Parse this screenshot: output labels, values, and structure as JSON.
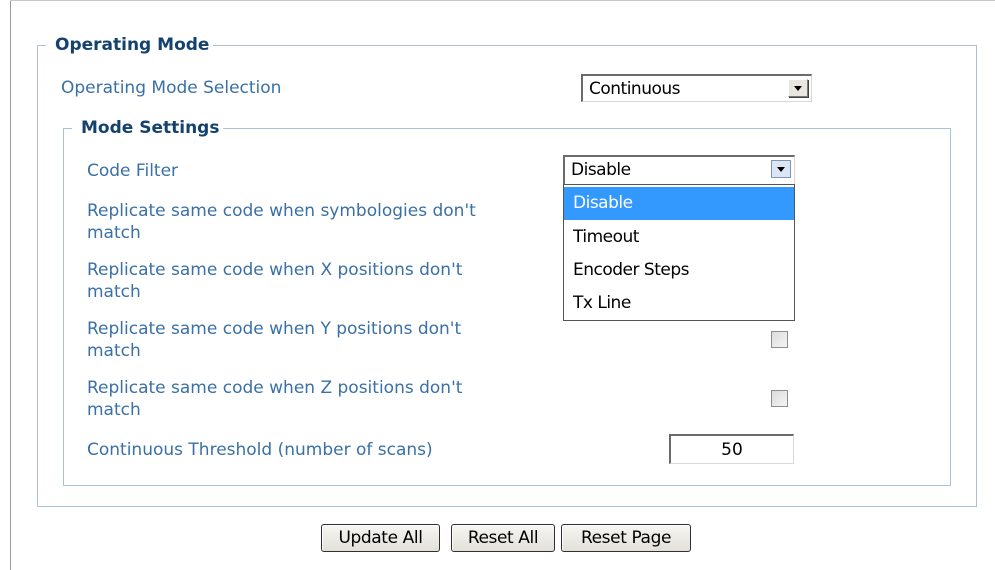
{
  "operating_mode": {
    "legend": "Operating Mode",
    "selection_label": "Operating Mode Selection",
    "selection_value": "Continuous"
  },
  "mode_settings": {
    "legend": "Mode Settings",
    "code_filter": {
      "label": "Code Filter",
      "value": "Disable",
      "options": [
        {
          "label": "Disable",
          "selected": true
        },
        {
          "label": "Timeout",
          "selected": false
        },
        {
          "label": "Encoder Steps",
          "selected": false
        },
        {
          "label": "Tx Line",
          "selected": false
        }
      ]
    },
    "replicate_symbologies": {
      "line1": "Replicate same code when symbologies don't",
      "line2": "match"
    },
    "replicate_x": {
      "line1": "Replicate same code when X positions don't",
      "line2": "match"
    },
    "replicate_y": {
      "line1": "Replicate same code when Y positions don't",
      "line2": "match",
      "checked": false
    },
    "replicate_z": {
      "line1": "Replicate same code when Z positions don't",
      "line2": "match",
      "checked": false
    },
    "continuous_threshold": {
      "label": "Continuous Threshold (number of scans)",
      "value": "50"
    }
  },
  "buttons": {
    "update_all": "Update All",
    "reset_all": "Reset All",
    "reset_page": "Reset Page"
  },
  "colors": {
    "legend_text": "#14426e",
    "label_text": "#3a70a6",
    "groupbox_border": "#a9c2d8",
    "dropdown_highlight": "#3399ff"
  }
}
